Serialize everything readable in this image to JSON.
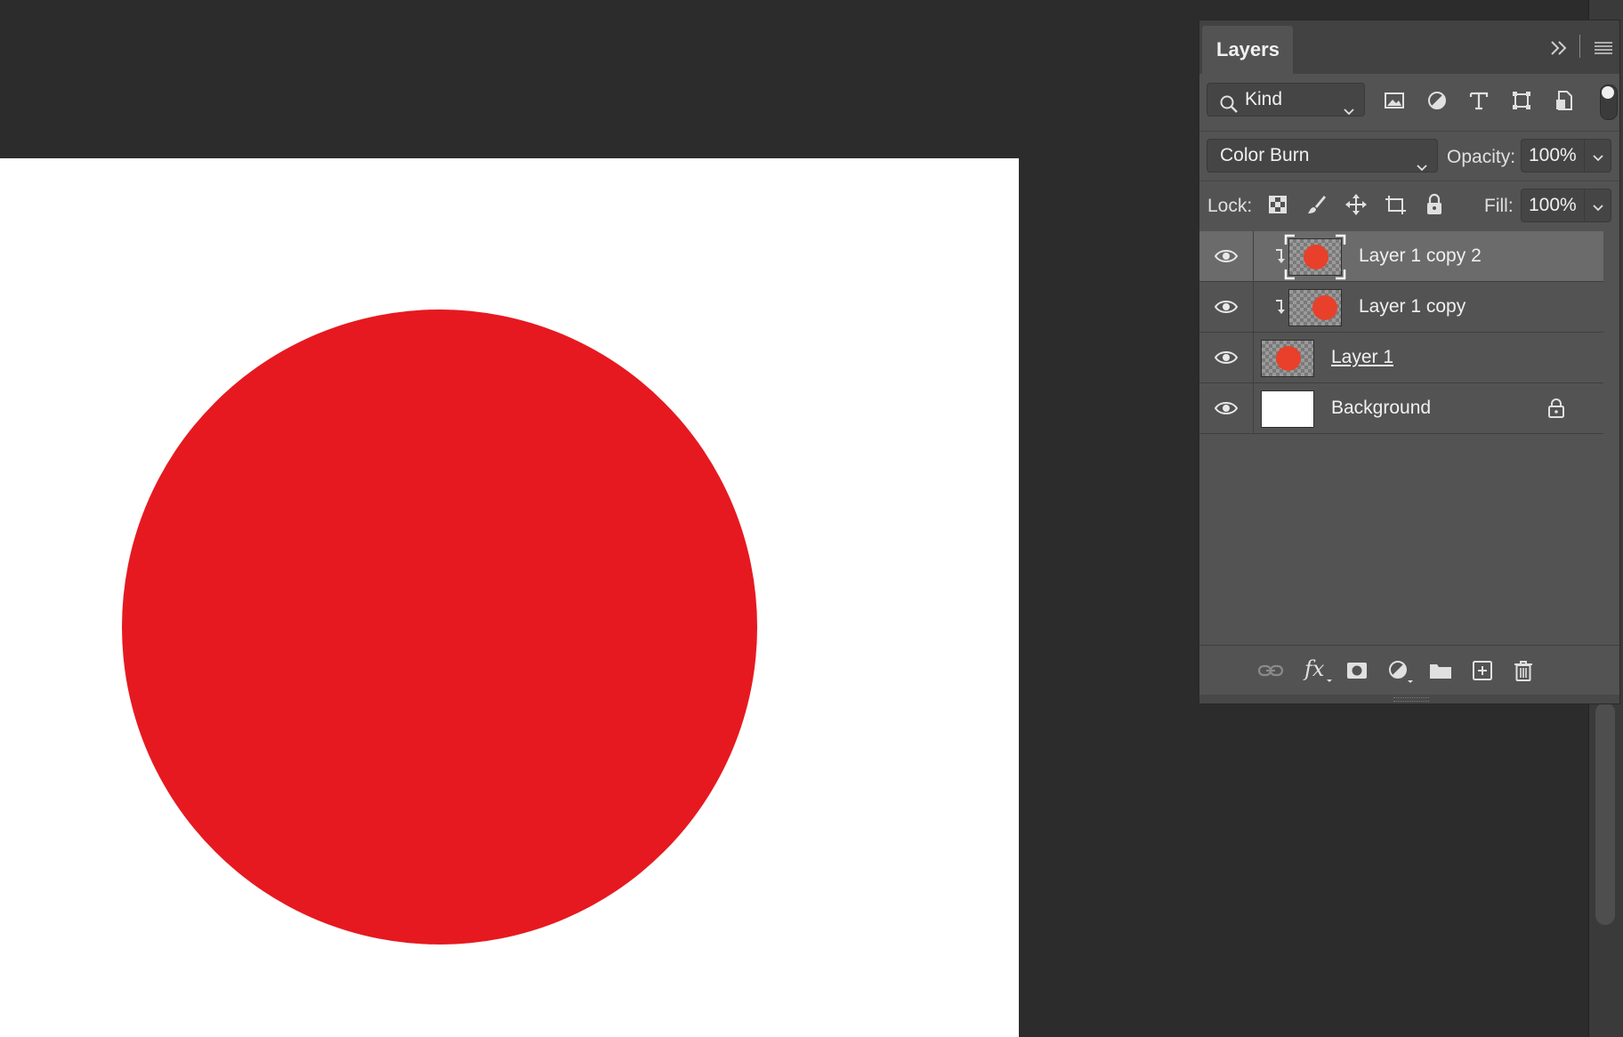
{
  "panel": {
    "title": "Layers",
    "filter": {
      "kind_label": "Kind"
    },
    "blend_mode": "Color Burn",
    "opacity_label": "Opacity:",
    "opacity_value": "100%",
    "lock_label": "Lock:",
    "fill_label": "Fill:",
    "fill_value": "100%",
    "layers": [
      {
        "name": "Layer 1 copy 2",
        "selected": true,
        "clipped": true,
        "thumb": "red-circle"
      },
      {
        "name": "Layer 1 copy",
        "selected": false,
        "clipped": true,
        "thumb": "red-circle"
      },
      {
        "name": "Layer 1",
        "selected": false,
        "clipped": false,
        "thumb": "red-circle",
        "underlined": true
      },
      {
        "name": "Background",
        "selected": false,
        "clipped": false,
        "thumb": "white",
        "locked": true
      }
    ]
  },
  "document": {
    "shape_color": "#e61920",
    "edge_color": "#ec4a2c"
  },
  "colors": {
    "accent": "#e8402a",
    "panel": "#535353",
    "canvas_bg": "#2c2c2c"
  }
}
